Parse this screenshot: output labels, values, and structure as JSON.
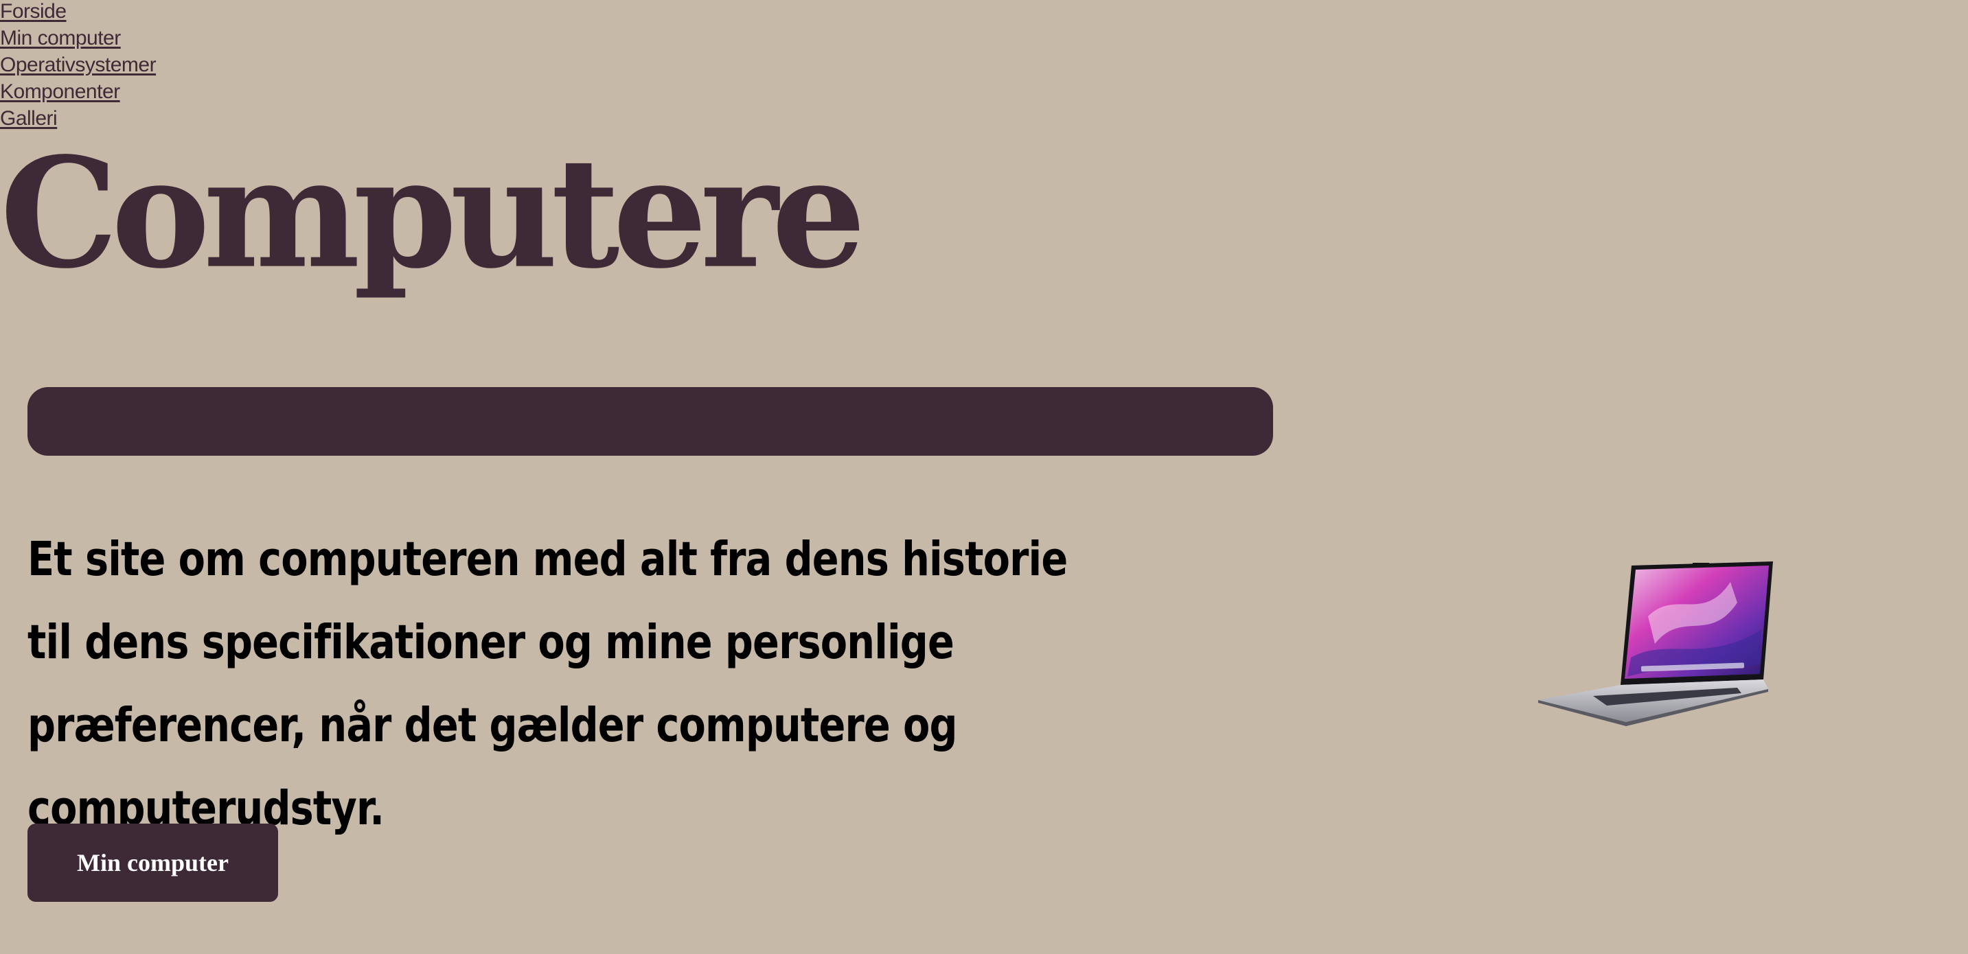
{
  "nav": {
    "items": [
      {
        "label": "Forside"
      },
      {
        "label": "Min computer"
      },
      {
        "label": "Operativsystemer"
      },
      {
        "label": "Komponenter"
      },
      {
        "label": "Galleri"
      }
    ]
  },
  "hero": {
    "title": "Computere",
    "intro": "Et site om computeren med alt fra dens historie til dens specifikationer og mine personlige præferencer, når det gælder computere og computerudstyr.",
    "button_label": "Min computer",
    "image": "laptop-image"
  },
  "colors": {
    "background": "#c7b9a8",
    "accent": "#3e2a36",
    "text": "#000000",
    "button_text": "#ffffff"
  }
}
